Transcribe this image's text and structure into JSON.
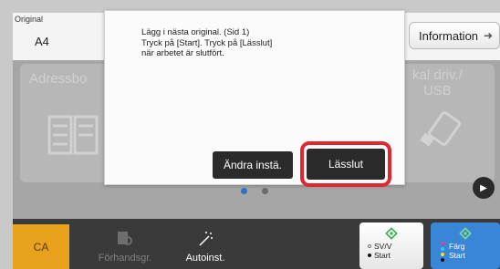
{
  "header": {
    "original_label": "Original",
    "original_value": "A4",
    "info_button": "Information",
    "info_arrow_icon": "right-arrow-icon"
  },
  "background_tiles": {
    "left_label": "Adressbo",
    "right_label_line1": "kal driv./",
    "right_label_line2": "USB"
  },
  "dialog": {
    "message": "Lägg i nästa original.  (Sid 1)\nTryck på [Start]. Tryck på [Lässlut]\nnär arbetet är slutfört.",
    "change_settings_button": "Ändra instä.",
    "read_end_button": "Lässlut",
    "highlight_color": "#e0262f"
  },
  "pager": {
    "active_index": 0,
    "count": 2
  },
  "bottom": {
    "ca_button": "CA",
    "preview_button": "Förhandsgr.",
    "auto_button": "Autoinst.",
    "start_bw_line1": "SV/V",
    "start_bw_line2": "Start",
    "start_color_line1": "Färg",
    "start_color_line2": "Start",
    "ca_color": "#e8a21b",
    "start_color_bg": "#3a86d6"
  }
}
